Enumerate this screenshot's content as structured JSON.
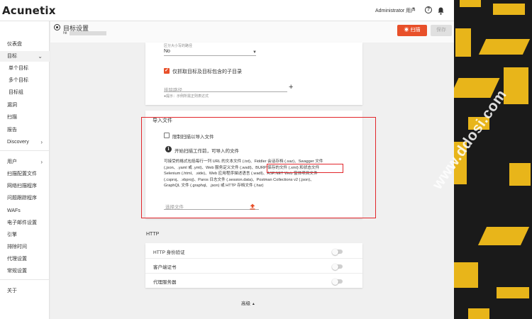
{
  "app": {
    "name": "Acunetix"
  },
  "topbar": {
    "user": "Administrator 用户",
    "help": "?"
  },
  "sidebar": {
    "items": [
      {
        "label": "仪表盘"
      },
      {
        "label": "目标"
      },
      {
        "label": "单个目标"
      },
      {
        "label": "多个目标"
      },
      {
        "label": "目标组"
      },
      {
        "label": "漏洞"
      },
      {
        "label": "扫描"
      },
      {
        "label": "报告"
      },
      {
        "label": "Discovery"
      },
      {
        "label": "用户"
      },
      {
        "label": "扫描配置文件"
      },
      {
        "label": "网络扫描程序"
      },
      {
        "label": "问题跟踪程序"
      },
      {
        "label": "WAFs"
      },
      {
        "label": "电子邮件设置"
      },
      {
        "label": "引擎"
      },
      {
        "label": "排除时间"
      },
      {
        "label": "代理设置"
      },
      {
        "label": "常规设置"
      },
      {
        "label": "关于"
      }
    ]
  },
  "header": {
    "title": "目标设置",
    "subtitle_prefix": "htt",
    "scan_label": "扫描",
    "save_label": "保存"
  },
  "crawl": {
    "select_label": "区分大小写的路径",
    "select_value": "No",
    "include_subdirs_label": "仅抓取目标及目标包含的子目录",
    "exclude_path_placeholder": "排除路径",
    "exclude_hint": "●提示：示例所需正则表达式"
  },
  "import": {
    "section_title": "导入文件",
    "restrict_label": "限制扫描以导入文件",
    "info_text": "开始扫描工作前，可导入的文件",
    "description": [
      "可接受的格式包括每行一列 URL 的文本文件 (.txt)、Fiddler 会话存档 (.saz)、Swagger 文件",
      "(.json、.yaml 或 .yml)、Web 服务定义文件 (.wsdl)、BURP 保存的文件 (.xml) 和状态文件",
      "Selenium (.html、.side)、Web 应用程序描述语言 (.wadl)、ASP.NET Web 窗体项目文件",
      "(.csproj、.vbproj)、Paros 日志文件 (.session.data)、Postman Collections v2 (.json)、",
      "GraphQL 文件 (.graphql、.json) 或 HTTP 存档文件 (.har)"
    ],
    "file_placeholder": "选择文件"
  },
  "http": {
    "section_title": "HTTP",
    "rows": [
      {
        "label": "HTTP 身份验证"
      },
      {
        "label": "客户端证书"
      },
      {
        "label": "代理服务器"
      }
    ]
  },
  "advanced_label": "高级",
  "watermark": "www.ddosi.com",
  "colors": {
    "accent": "#e8502a",
    "highlight": "#e2262b",
    "deco_gold": "#e8b51a"
  }
}
